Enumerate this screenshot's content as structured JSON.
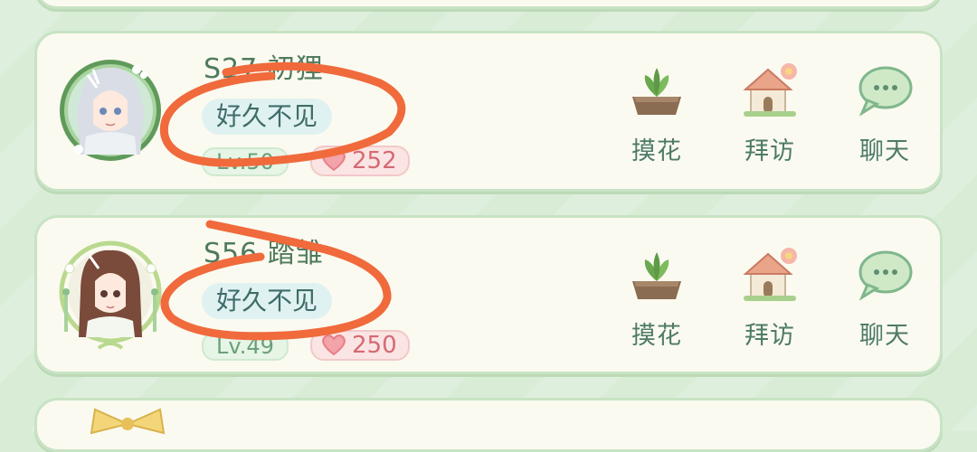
{
  "cards": [
    {
      "name": "S27 初狸",
      "status": "好久不见",
      "level": "Lv.50",
      "hearts": "252",
      "actions": [
        {
          "label": "摸花",
          "icon": "plant-pot-icon"
        },
        {
          "label": "拜访",
          "icon": "house-icon"
        },
        {
          "label": "聊天",
          "icon": "chat-bubble-icon"
        }
      ]
    },
    {
      "name": "S56 踏雏",
      "status": "好久不见",
      "level": "Lv.49",
      "hearts": "250",
      "actions": [
        {
          "label": "摸花",
          "icon": "plant-pot-icon"
        },
        {
          "label": "拜访",
          "icon": "house-icon"
        },
        {
          "label": "聊天",
          "icon": "chat-bubble-icon"
        }
      ]
    }
  ],
  "colors": {
    "background": "#d8ecd6",
    "card": "#fbfaf0",
    "annotation": "#f06a3c",
    "heart": "#e77e86"
  }
}
